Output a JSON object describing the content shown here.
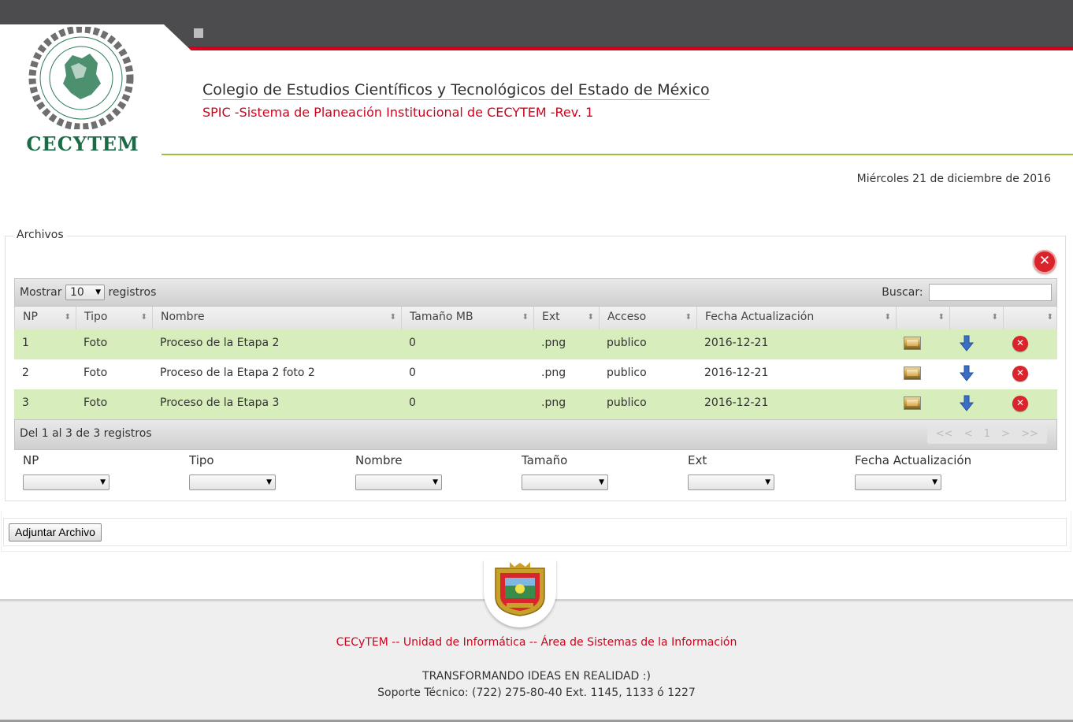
{
  "header": {
    "logo_text": "CECYTEM",
    "institution_title": "Colegio de Estudios Científicos y Tecnológicos del Estado de México",
    "system_title": "SPIC -Sistema de Planeación Institucional de CECYTEM -Rev. 1",
    "date": "Miércoles 21 de diciembre de 2016"
  },
  "archivos": {
    "legend": "Archivos",
    "length_label_before": "Mostrar",
    "length_value": "10",
    "length_label_after": "registros",
    "search_label": "Buscar:",
    "search_value": "",
    "columns": [
      "NP",
      "Tipo",
      "Nombre",
      "Tamaño MB",
      "Ext",
      "Acceso",
      "Fecha Actualización",
      "",
      "",
      ""
    ],
    "rows": [
      {
        "np": "1",
        "tipo": "Foto",
        "nombre": "Proceso de la Etapa 2",
        "tamano": "0",
        "ext": ".png",
        "acceso": "publico",
        "fecha": "2016-12-21"
      },
      {
        "np": "2",
        "tipo": "Foto",
        "nombre": "Proceso de la Etapa 2 foto 2",
        "tamano": "0",
        "ext": ".png",
        "acceso": "publico",
        "fecha": "2016-12-21"
      },
      {
        "np": "3",
        "tipo": "Foto",
        "nombre": "Proceso de la Etapa 3",
        "tamano": "0",
        "ext": ".png",
        "acceso": "publico",
        "fecha": "2016-12-21"
      }
    ],
    "info": "Del 1 al 3 de 3 registros",
    "pager": {
      "first": "<<",
      "prev": "<",
      "page": "1",
      "next": ">",
      "last": ">>"
    },
    "filters": [
      "NP",
      "Tipo",
      "Nombre",
      "Tamaño",
      "Ext",
      "Fecha Actualización"
    ]
  },
  "attach_button": "Adjuntar Archivo",
  "footer": {
    "unit": "CECyTEM -- Unidad de Informática -- Área de Sistemas de la Información",
    "motto": "TRANSFORMANDO IDEAS EN REALIDAD :)",
    "support": "Soporte Técnico: (722) 275-80-40 Ext. 1145, 1133 ó 1227"
  },
  "colors": {
    "brand_red": "#d0021b",
    "brand_green": "#9cc03b",
    "row_highlight": "#d7edbc",
    "topbar": "#4c4c4e"
  },
  "icons": [
    "image-icon",
    "download-icon",
    "delete-icon",
    "close-icon",
    "sort-icon",
    "chevron-down-icon"
  ]
}
